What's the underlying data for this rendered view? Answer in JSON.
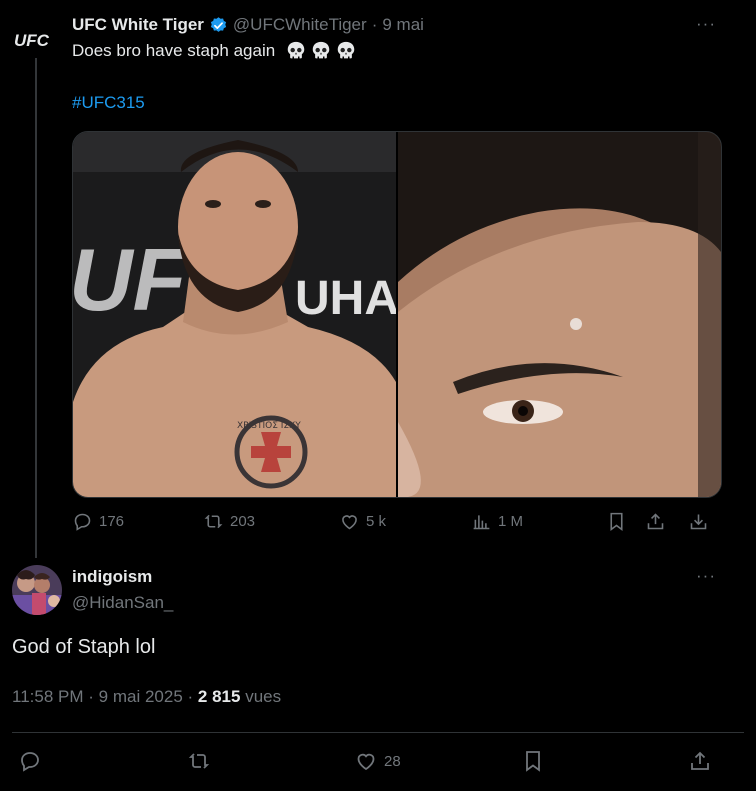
{
  "quoted_tweet": {
    "logo_text": "UFC",
    "author_name": "UFC White Tiger",
    "author_handle": "@UFCWhiteTiger",
    "separator": "·",
    "date": "9 mai",
    "text": "Does bro have staph again",
    "emoji_icons": [
      "skull-emoji",
      "skull-emoji",
      "skull-emoji"
    ],
    "hashtag": "#UFC315",
    "more_label": "···",
    "media": {
      "left_banner_text": "UFC",
      "left_banner_text2": "UHA",
      "tattoo_text": "XPISTIOΣ ΙΣΧΥ"
    },
    "stats": {
      "replies": "176",
      "reposts": "203",
      "likes": "5 k",
      "views": "1 M"
    }
  },
  "reply": {
    "author_name": "indigoism",
    "author_handle": "@HidanSan_",
    "more_label": "···",
    "text": "God of Staph lol",
    "time": "11:58 PM",
    "sep": "·",
    "date": "9 mai 2025",
    "sep2": "·",
    "views_count": "2 815",
    "views_label": "vues",
    "likes": "28"
  },
  "colors": {
    "background": "#000000",
    "text": "#e7e9ea",
    "muted": "#71767b",
    "link": "#1d9bf0",
    "verified": "#1d9bf0"
  }
}
